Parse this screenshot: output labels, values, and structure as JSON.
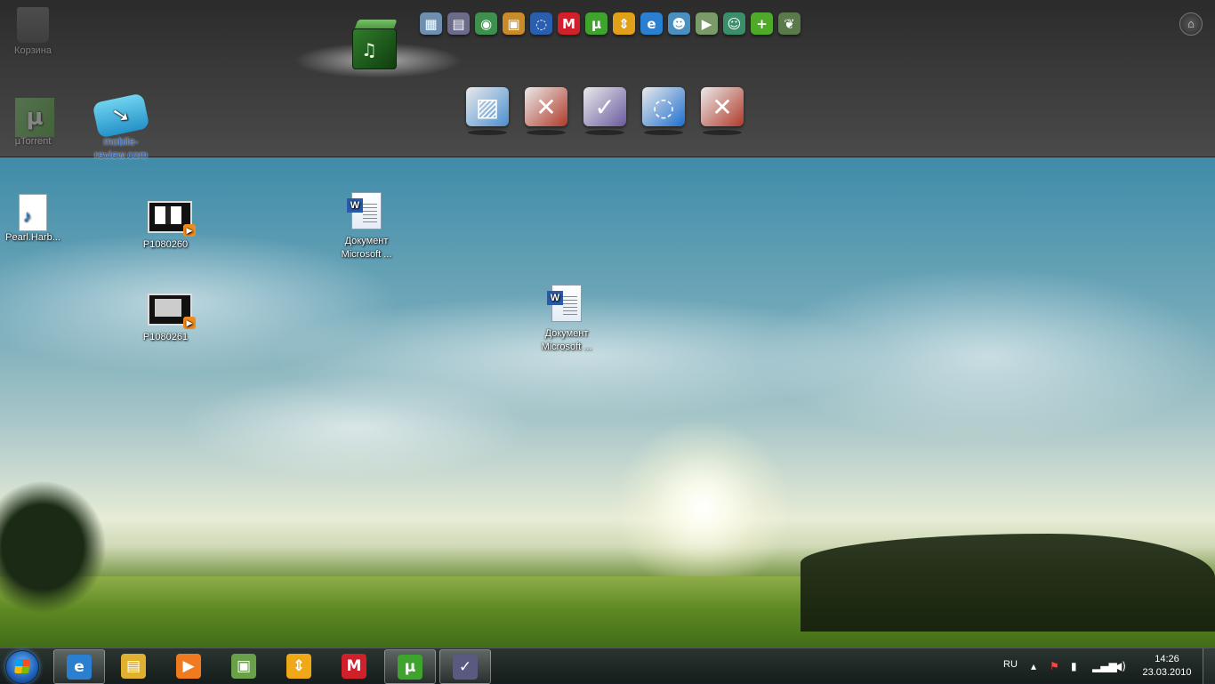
{
  "desktop": {
    "icons": [
      {
        "label": "Корзина",
        "kind": "recycle-bin"
      },
      {
        "label": "µTorrent",
        "kind": "shortcut"
      },
      {
        "label": "mobile-review.com",
        "kind": "shortcut"
      },
      {
        "label": "Pearl.Harb...",
        "kind": "audio-file"
      },
      {
        "label": "P1080260",
        "kind": "video-file"
      },
      {
        "label": "P1080261",
        "kind": "video-file"
      },
      {
        "label": "Документ Microsoft ...",
        "kind": "word-document"
      },
      {
        "label": "Документ Microsoft ...",
        "kind": "word-document"
      }
    ]
  },
  "dock": {
    "main_app": "media-cube",
    "small_icons": [
      {
        "name": "network-icon",
        "glyph": "▦",
        "color": "#6f8fb0"
      },
      {
        "name": "explorer-icon",
        "glyph": "▤",
        "color": "#6b6b8a"
      },
      {
        "name": "globe-icon",
        "glyph": "◉",
        "color": "#3f8f4f"
      },
      {
        "name": "package-icon",
        "glyph": "▣",
        "color": "#c98a2a"
      },
      {
        "name": "sync-icon",
        "glyph": "◌",
        "color": "#2a5fb0"
      },
      {
        "name": "mail-ru-agent-icon",
        "glyph": "M",
        "color": "#d0202a"
      },
      {
        "name": "utorrent-icon",
        "glyph": "µ",
        "color": "#3fa42e"
      },
      {
        "name": "download-icon",
        "glyph": "⇕",
        "color": "#e0a018"
      },
      {
        "name": "internet-explorer-icon",
        "glyph": "e",
        "color": "#2a7fd0"
      },
      {
        "name": "people-icon",
        "glyph": "☻",
        "color": "#4a8fc0"
      },
      {
        "name": "media-center-icon",
        "glyph": "▶",
        "color": "#7a9a6a"
      },
      {
        "name": "contacts-icon",
        "glyph": "☺",
        "color": "#3a8f6a"
      },
      {
        "name": "add-gadget-icon",
        "glyph": "+",
        "color": "#4faa2a"
      },
      {
        "name": "evernote-icon",
        "glyph": "❦",
        "color": "#5a7a4a"
      }
    ],
    "large_icons": [
      {
        "name": "photo-gallery-icon",
        "glyph": "▨",
        "color": "#4a8fd0"
      },
      {
        "name": "vaio-media-icon",
        "glyph": "✕",
        "color": "#b03a2a"
      },
      {
        "name": "vaio-care-icon",
        "glyph": "✓",
        "color": "#6a5aa0"
      },
      {
        "name": "vaio-update-icon",
        "glyph": "◌",
        "color": "#1e6fd0"
      },
      {
        "name": "vaio-media-plus-icon",
        "glyph": "✕",
        "color": "#b03a2a"
      }
    ]
  },
  "taskbar": {
    "pinned": [
      {
        "name": "taskbar-internet-explorer",
        "glyph": "e",
        "color": "#2a7fd0",
        "active": true
      },
      {
        "name": "taskbar-windows-explorer",
        "glyph": "▤",
        "color": "#e0b030",
        "active": false
      },
      {
        "name": "taskbar-media-player",
        "glyph": "▶",
        "color": "#f07a20",
        "active": false
      },
      {
        "name": "taskbar-media-center",
        "glyph": "▣",
        "color": "#6aa04a",
        "active": false
      },
      {
        "name": "taskbar-download-master",
        "glyph": "⇕",
        "color": "#f0a818",
        "active": false
      },
      {
        "name": "taskbar-mail-agent",
        "glyph": "M",
        "color": "#d0202a",
        "active": false
      },
      {
        "name": "taskbar-utorrent",
        "glyph": "µ",
        "color": "#3fa42e",
        "active": true
      },
      {
        "name": "taskbar-vaio-care",
        "glyph": "✓",
        "color": "#5a5a80",
        "active": true
      }
    ],
    "tray": {
      "language": "RU",
      "time": "14:26",
      "date": "23.03.2010"
    }
  }
}
